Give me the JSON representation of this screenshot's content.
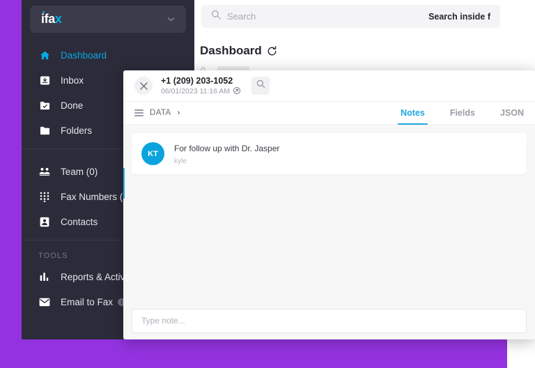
{
  "theme": {
    "backdrop_purple": "#9333e0",
    "sidebar_bg": "#2b2b3a",
    "accent_blue": "#0aa7e0",
    "tab_active_blue": "#1ea7dd",
    "avatar_blue": "#0aa3dd"
  },
  "sidebar": {
    "brand": {
      "name_white": "ifa",
      "name_accent": "x",
      "chevron": "chevron-down-icon"
    },
    "items": [
      {
        "label": "Dashboard",
        "icon": "home-icon",
        "active": true
      },
      {
        "label": "Inbox",
        "icon": "inbox-icon",
        "active": false
      },
      {
        "label": "Done",
        "icon": "folder-check-icon",
        "active": false
      },
      {
        "label": "Folders",
        "icon": "folder-icon",
        "active": false
      }
    ],
    "items2": [
      {
        "label": "Team (0)",
        "icon": "team-icon",
        "active": false
      },
      {
        "label": "Fax Numbers (1",
        "icon": "keypad-icon",
        "active": false
      },
      {
        "label": "Contacts",
        "icon": "contact-card-icon",
        "active": false
      }
    ],
    "tools_label": "TOOLS",
    "tools": [
      {
        "label": "Reports & Activi",
        "icon": "bar-chart-icon",
        "info": false
      },
      {
        "label": "Email to Fax",
        "icon": "envelope-icon",
        "info": true
      }
    ],
    "info_glyph": "i"
  },
  "main": {
    "search": {
      "placeholder": "Search",
      "icon": "search-icon",
      "inside_label": "Search inside f"
    },
    "page_title": "Dashboard",
    "refresh_icon": "refresh-icon"
  },
  "modal": {
    "close_icon": "close-icon",
    "fax_number": "+1 (209) 203-1052",
    "timestamp": "06/01/2023 11:16 AM",
    "external_link_icon": "external-link-icon",
    "header_search_icon": "search-icon",
    "data_label": "DATA",
    "data_menu_icon": "hamburger-icon",
    "data_chevron": "›",
    "tabs": [
      {
        "label": "Notes",
        "active": true
      },
      {
        "label": "Fields",
        "active": false
      },
      {
        "label": "JSON",
        "active": false
      }
    ],
    "note": {
      "avatar_initials": "KT",
      "body": "For follow up with Dr. Jasper",
      "author": "kyle"
    },
    "note_input_placeholder": "Type note..."
  }
}
